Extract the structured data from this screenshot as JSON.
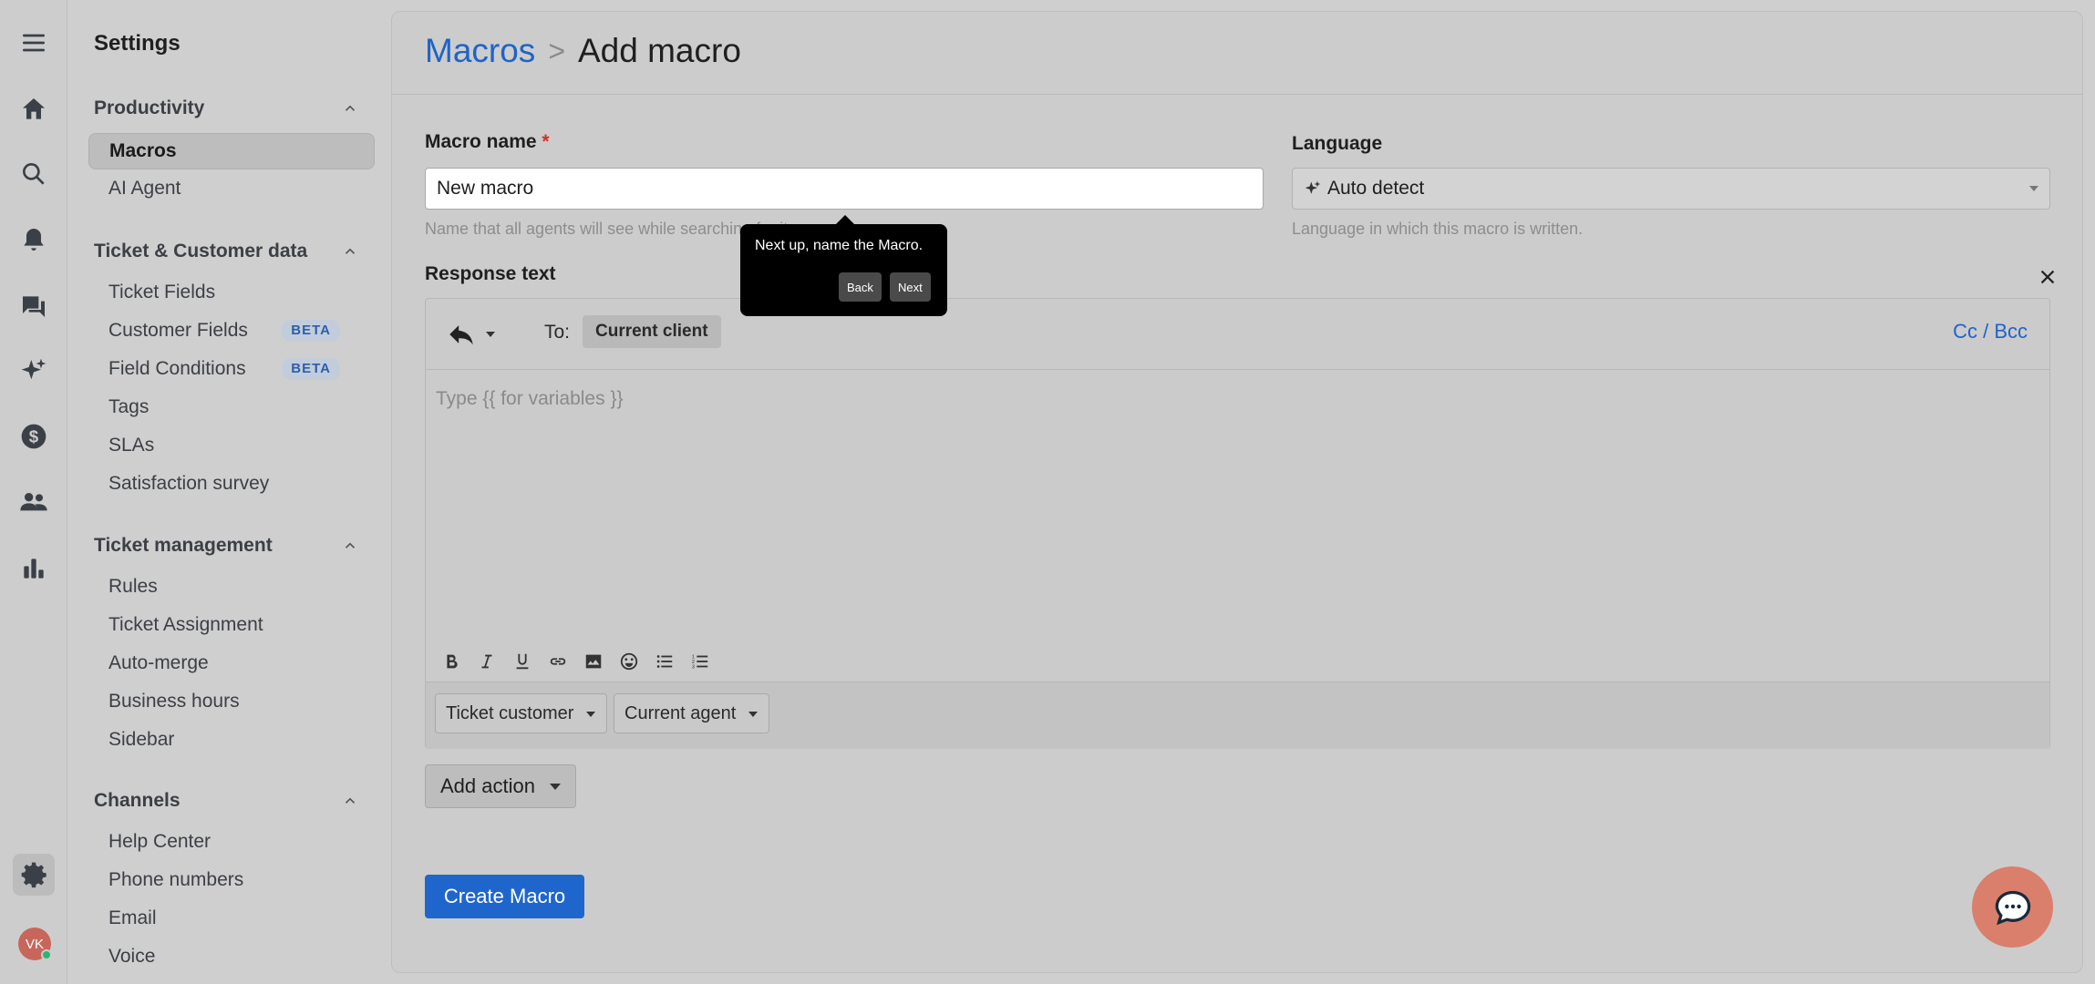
{
  "rail": {
    "icons": [
      "menu-icon",
      "home-icon",
      "search-icon",
      "bell-icon",
      "chat-icon",
      "sparkle-icon",
      "dollar-icon",
      "users-icon",
      "bar-chart-icon",
      "gear-icon"
    ],
    "avatar_initials": "VK"
  },
  "settings": {
    "title": "Settings",
    "sections": [
      {
        "title": "Productivity",
        "items": [
          {
            "label": "Macros",
            "active": true
          },
          {
            "label": "AI Agent"
          }
        ]
      },
      {
        "title": "Ticket & Customer data",
        "items": [
          {
            "label": "Ticket Fields"
          },
          {
            "label": "Customer Fields",
            "badge": "BETA"
          },
          {
            "label": "Field Conditions",
            "badge": "BETA"
          },
          {
            "label": "Tags"
          },
          {
            "label": "SLAs"
          },
          {
            "label": "Satisfaction survey"
          }
        ]
      },
      {
        "title": "Ticket management",
        "items": [
          {
            "label": "Rules"
          },
          {
            "label": "Ticket Assignment"
          },
          {
            "label": "Auto-merge"
          },
          {
            "label": "Business hours"
          },
          {
            "label": "Sidebar"
          }
        ]
      },
      {
        "title": "Channels",
        "items": [
          {
            "label": "Help Center"
          },
          {
            "label": "Phone numbers"
          },
          {
            "label": "Email"
          },
          {
            "label": "Voice"
          }
        ]
      }
    ]
  },
  "header": {
    "breadcrumb_link": "Macros",
    "separator": ">",
    "current": "Add macro"
  },
  "form": {
    "name_label": "Macro name",
    "required_mark": "*",
    "name_value": "New macro",
    "name_help": "Name that all agents will see while searching for it",
    "language_label": "Language",
    "language_value": "Auto detect",
    "language_help": "Language in which this macro is written.",
    "response_label": "Response text"
  },
  "editor": {
    "to_label": "To:",
    "to_chip": "Current client",
    "cc_bcc": "Cc / Bcc",
    "placeholder": "Type {{ for variables }}",
    "format_icons": [
      "bold-icon",
      "italic-icon",
      "underline-icon",
      "link-icon",
      "image-icon",
      "emoji-icon",
      "bullet-list-icon",
      "numbered-list-icon"
    ],
    "variable_buttons": [
      "Ticket customer",
      "Current agent"
    ]
  },
  "actions": {
    "add_action": "Add action",
    "create": "Create Macro"
  },
  "tooltip": {
    "text": "Next up, name the Macro.",
    "back": "Back",
    "next": "Next"
  }
}
